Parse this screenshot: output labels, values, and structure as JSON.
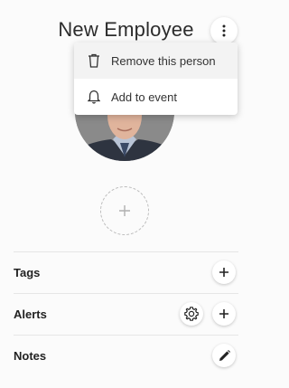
{
  "header": {
    "title": "New Employee",
    "more_icon": "more-vertical-icon"
  },
  "menu": {
    "items": [
      {
        "label": "Remove this person",
        "icon": "trash-icon"
      },
      {
        "label": "Add to event",
        "icon": "bell-icon"
      }
    ]
  },
  "photo": {
    "add_icon": "plus-icon"
  },
  "sections": {
    "tags": {
      "label": "Tags"
    },
    "alerts": {
      "label": "Alerts"
    },
    "notes": {
      "label": "Notes"
    }
  },
  "colors": {
    "background": "#fbfbfb",
    "divider": "#e6e6e6",
    "icon": "#222222"
  }
}
